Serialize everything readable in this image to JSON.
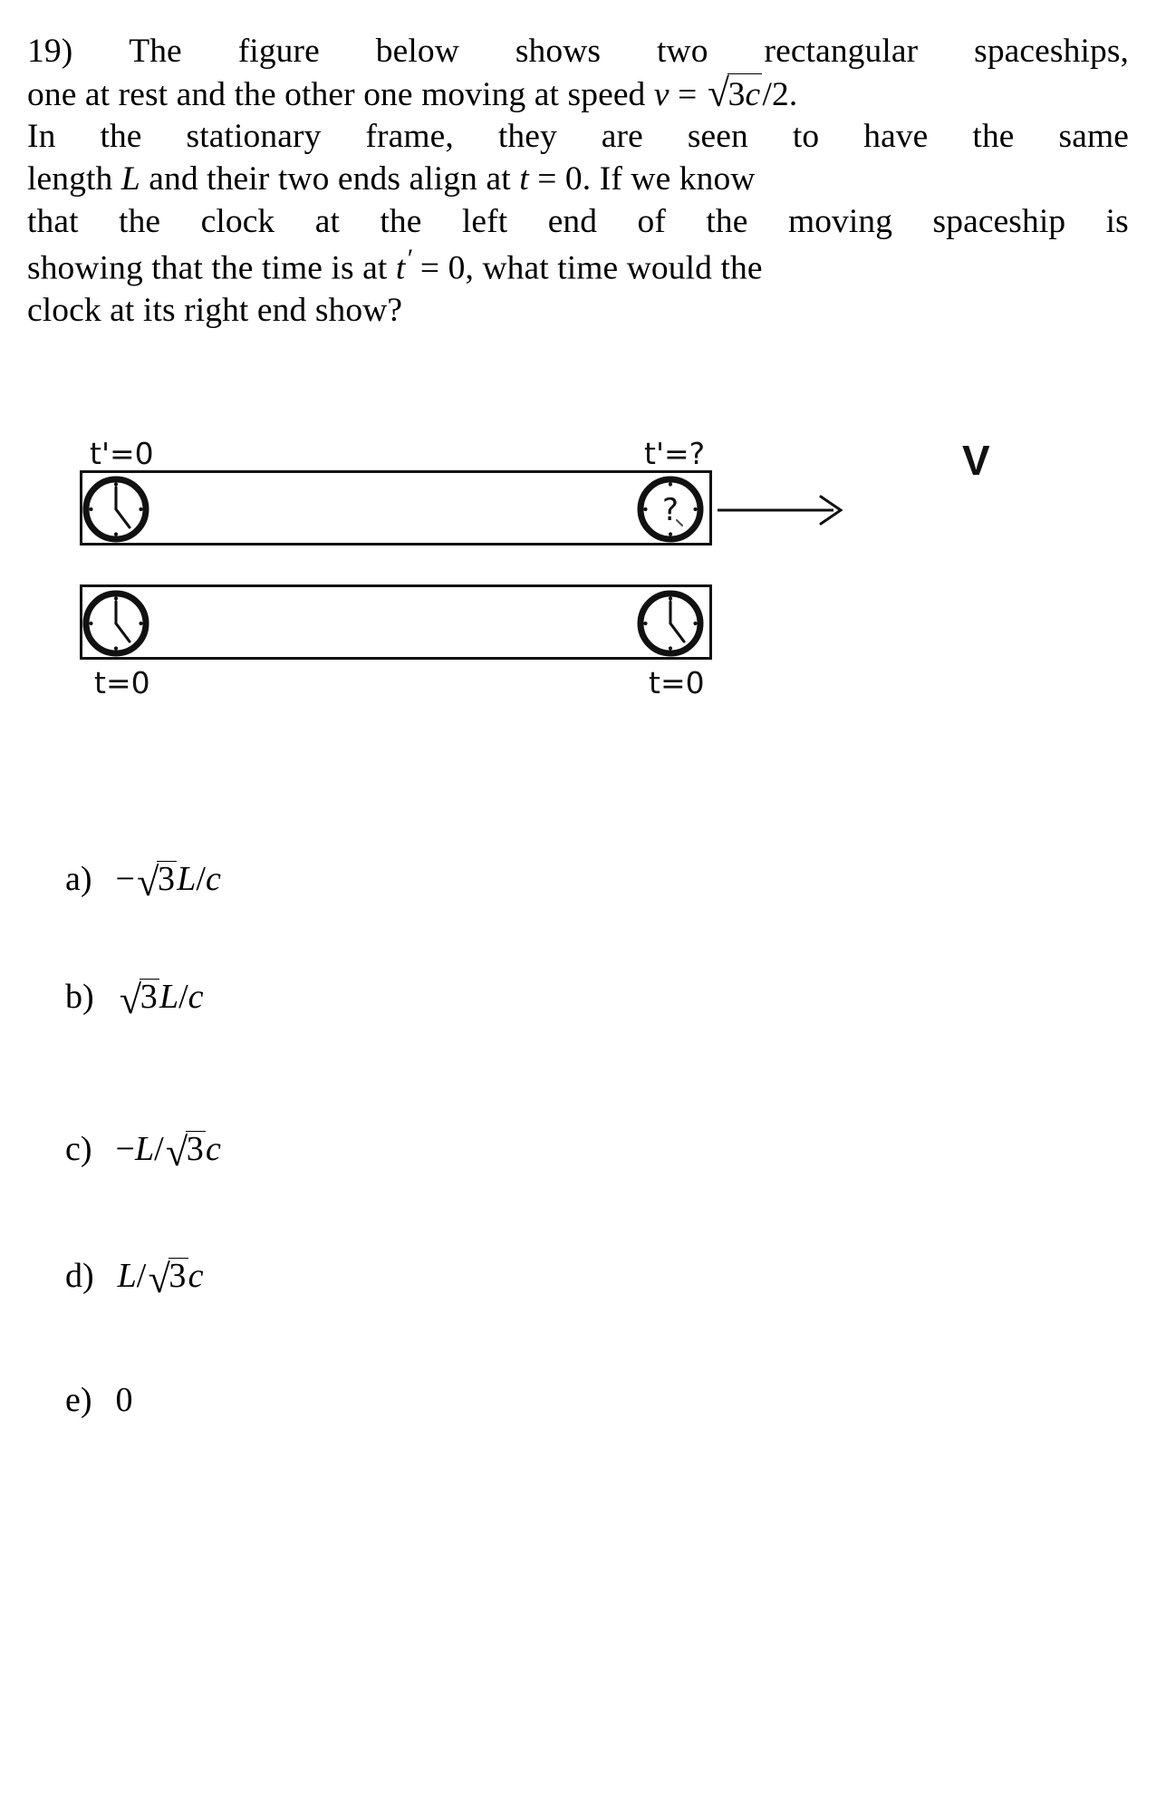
{
  "question": {
    "number": "19)",
    "full_text": "19) The figure below shows two rectangular spaceships, one at rest and the other one moving at speed v = √3c/2. In the stationary frame, they are seen to have the same length L and their two ends align at t = 0. If we know that the clock at the left end of the moving spaceship is showing that the time is at t' = 0, what time would the clock at its right end show?",
    "lines": [
      {
        "segments": [
          "19)",
          "The",
          "figure",
          "below",
          "shows",
          "two",
          "rectangular",
          "spaceships,"
        ]
      },
      {
        "segments": [
          "one at rest and the other one moving at speed ",
          "v",
          " = ",
          "√3c/2."
        ]
      },
      {
        "segments": [
          "In",
          "the",
          "stationary",
          "frame,",
          "they",
          "are",
          "seen",
          "to",
          "have",
          "the",
          "same"
        ]
      },
      {
        "segments": [
          "length ",
          "L",
          " and their two ends align at ",
          "t",
          " = 0.",
          " If we know"
        ]
      },
      {
        "segments": [
          "that",
          "the",
          "clock",
          "at",
          "the",
          "left",
          "end",
          "of",
          "the",
          "moving",
          "spaceship",
          "is"
        ]
      },
      {
        "segments": [
          "showing that the time is at ",
          "t'",
          " = 0,",
          " what time would the"
        ]
      },
      {
        "segments": [
          "clock at its right end show?"
        ]
      }
    ],
    "symbols": {
      "speed_var": "v",
      "speed_value_radicand": "3c",
      "speed_value_denominator": "2",
      "length_var": "L",
      "time_var": "t",
      "proper_time_var": "t",
      "zero": "0"
    }
  },
  "figure": {
    "moving_ship": {
      "left_label": "t'=0",
      "right_label": "t'=?",
      "left_clock": {
        "type": "clock-face",
        "reading": "hands",
        "hour": 5,
        "minute": 0
      },
      "right_clock": {
        "type": "clock-face",
        "reading": "question-mark",
        "glyph": "?"
      }
    },
    "rest_ship": {
      "left_label": "t=0",
      "right_label": "t=0",
      "left_clock": {
        "type": "clock-face",
        "reading": "hands",
        "hour": 5,
        "minute": 0
      },
      "right_clock": {
        "type": "clock-face",
        "reading": "hands",
        "hour": 5,
        "minute": 0
      }
    },
    "velocity_arrow": {
      "label": "V",
      "direction": "right"
    },
    "colors": {
      "stroke": "#111111",
      "background": "#ffffff"
    }
  },
  "options": [
    {
      "tag": "a)",
      "expr_plain": "−√3L/c",
      "sign": "−",
      "radicand": "3",
      "numerator_tail": "L",
      "denominator": "c"
    },
    {
      "tag": "b)",
      "expr_plain": "√3L/c",
      "sign": "",
      "radicand": "3",
      "numerator_tail": "L",
      "denominator": "c"
    },
    {
      "tag": "c)",
      "expr_plain": "−L/√3c",
      "sign": "−",
      "numerator": "L",
      "radicand": "3",
      "denominator_tail": "c"
    },
    {
      "tag": "d)",
      "expr_plain": "L/√3c",
      "sign": "",
      "numerator": "L",
      "radicand": "3",
      "denominator_tail": "c"
    },
    {
      "tag": "e)",
      "expr_plain": "0",
      "value": "0"
    }
  ]
}
